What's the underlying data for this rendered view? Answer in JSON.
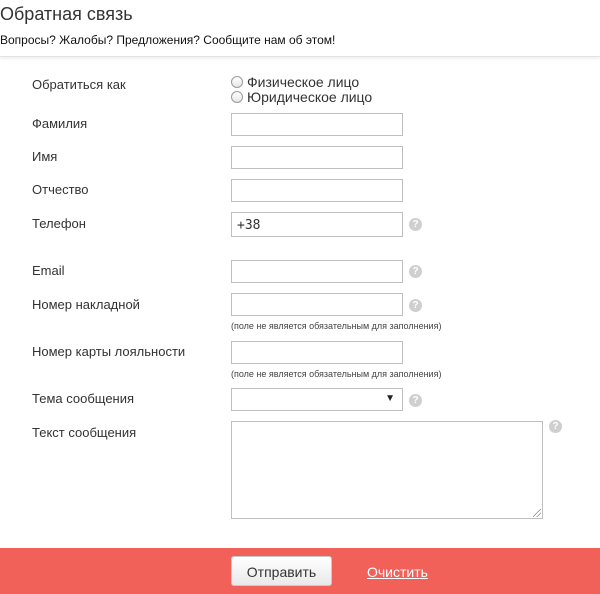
{
  "header": {
    "title": "Обратная связь",
    "subtitle": "Вопросы? Жалобы? Предложения? Сообщите нам об этом!"
  },
  "form": {
    "contact_as": {
      "label": "Обратиться как",
      "options": [
        "Физическое лицо",
        "Юридическое лицо"
      ]
    },
    "surname": {
      "label": "Фамилия",
      "value": ""
    },
    "name": {
      "label": "Имя",
      "value": ""
    },
    "patronymic": {
      "label": "Отчество",
      "value": ""
    },
    "phone": {
      "label": "Телефон",
      "value": "+38"
    },
    "email": {
      "label": "Email",
      "value": ""
    },
    "waybill": {
      "label": "Номер накладной",
      "value": "",
      "hint": "(поле не является обязательным для заполнения)"
    },
    "loyalty_card": {
      "label": "Номер карты лояльности",
      "value": "",
      "hint": "(поле не является обязательным для заполнения)"
    },
    "subject": {
      "label": "Тема сообщения",
      "value": ""
    },
    "message": {
      "label": "Текст сообщения",
      "value": ""
    },
    "help_symbol": "?"
  },
  "footer": {
    "send_label": "Отправить",
    "clear_label": "Очистить",
    "background": "#f2605a"
  },
  "icons": {
    "help": "question-circle-icon",
    "dropdown": "caret-down-icon"
  }
}
